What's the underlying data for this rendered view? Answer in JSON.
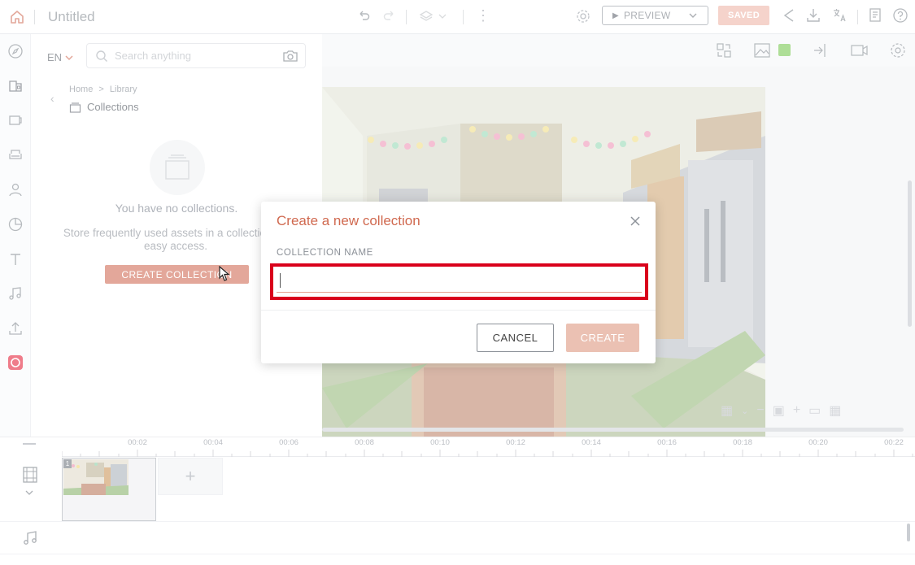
{
  "topbar": {
    "title": "Untitled",
    "preview_label": "PREVIEW",
    "saved_label": "SAVED"
  },
  "panel": {
    "language": "EN",
    "search_placeholder": "Search anything",
    "breadcrumb_home": "Home",
    "breadcrumb_sep": ">",
    "breadcrumb_library": "Library",
    "section_title": "Collections",
    "empty_title": "You have no collections.",
    "empty_desc": "Store frequently used assets in a collection for easy access.",
    "create_collection_label": "CREATE COLLECTION"
  },
  "modal": {
    "title": "Create a new collection",
    "field_label": "COLLECTION NAME",
    "field_value": "",
    "cancel_label": "CANCEL",
    "create_label": "CREATE"
  },
  "timeline": {
    "ticks": [
      "00:02",
      "00:04",
      "00:06",
      "00:08",
      "00:10",
      "00:12",
      "00:14",
      "00:16",
      "00:18",
      "00:20",
      "00:22"
    ],
    "scene_number": "1",
    "add_scene_label": "+"
  },
  "colors": {
    "accent": "#d0694f",
    "button_primary": "#d98673",
    "highlight_border": "#d9001b"
  }
}
